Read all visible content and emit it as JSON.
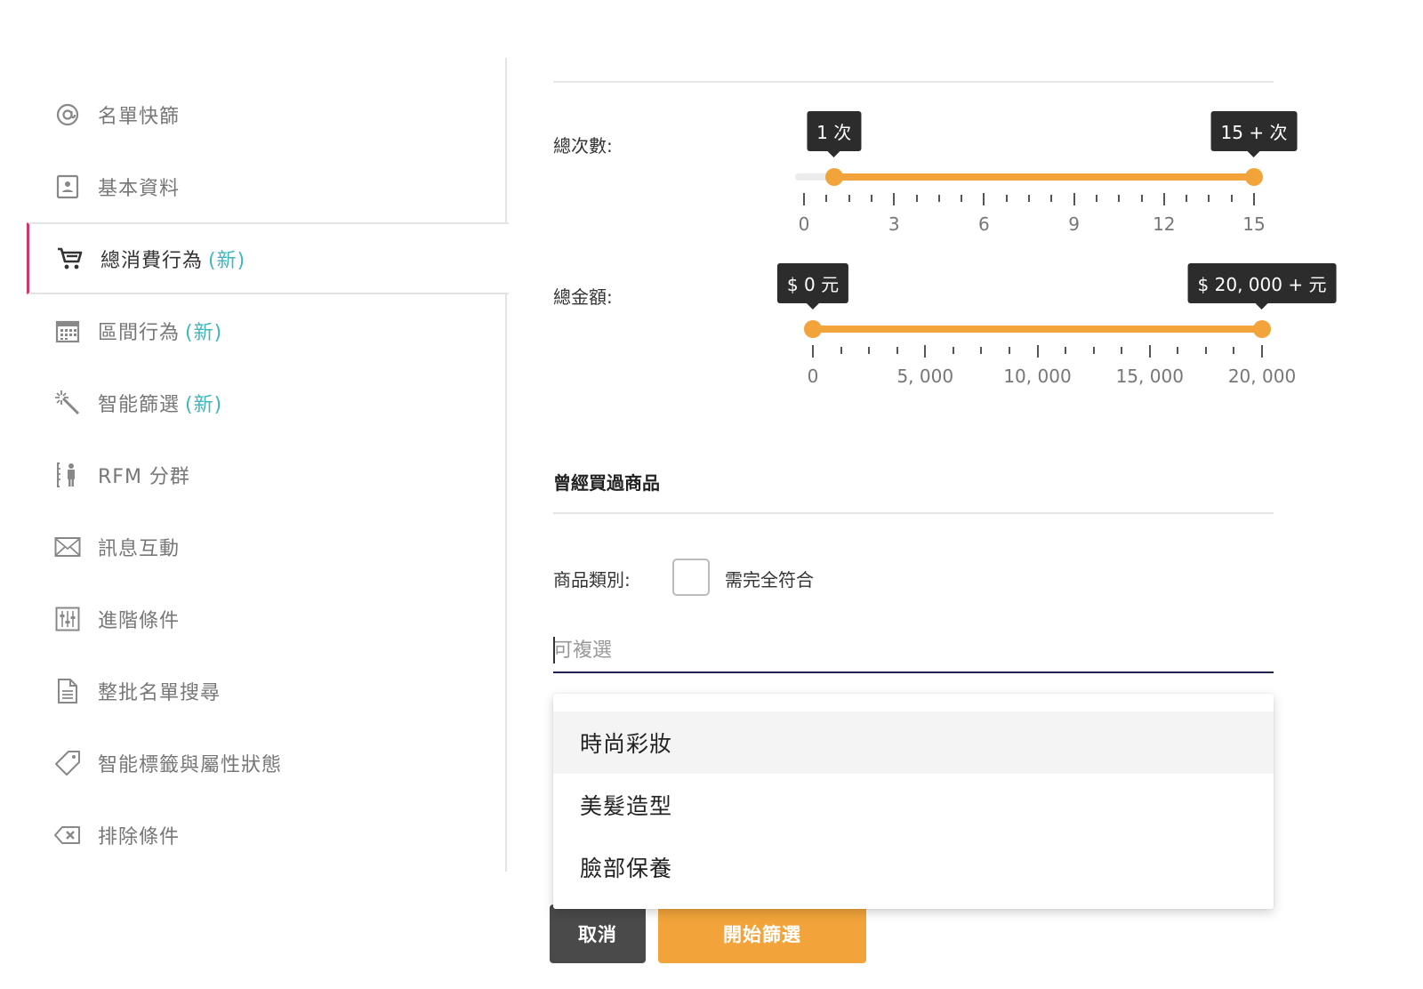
{
  "sidebar": {
    "items": [
      {
        "icon": "at-icon",
        "label": "名單快篩",
        "new": ""
      },
      {
        "icon": "id-card-icon",
        "label": "基本資料",
        "new": ""
      },
      {
        "icon": "cart-icon",
        "label": "總消費行為",
        "new": "(新)"
      },
      {
        "icon": "calendar-icon",
        "label": "區間行為",
        "new": "(新)"
      },
      {
        "icon": "magic-wand-icon",
        "label": "智能篩選",
        "new": "(新)"
      },
      {
        "icon": "rfm-person-icon",
        "label": "RFM 分群",
        "new": ""
      },
      {
        "icon": "envelope-icon",
        "label": "訊息互動",
        "new": ""
      },
      {
        "icon": "sliders-icon",
        "label": "進階條件",
        "new": ""
      },
      {
        "icon": "document-icon",
        "label": "整批名單搜尋",
        "new": ""
      },
      {
        "icon": "tag-icon",
        "label": "智能標籤與屬性狀態",
        "new": ""
      },
      {
        "icon": "backspace-icon",
        "label": "排除條件",
        "new": ""
      }
    ],
    "active_index": 2
  },
  "count_slider": {
    "label": "總次數:",
    "low_tip": "1 次",
    "high_tip": "15 + 次",
    "min": 0,
    "max": 15,
    "low": 1,
    "high": 15,
    "tick_labels": [
      "0",
      "3",
      "6",
      "9",
      "12",
      "15"
    ]
  },
  "amount_slider": {
    "label": "總金額:",
    "low_tip": "$ 0 元",
    "high_tip": "$ 20, 000 + 元",
    "min": 0,
    "max": 20000,
    "low": 0,
    "high": 20000,
    "tick_labels": [
      "0",
      "5, 000",
      "10, 000",
      "15, 000",
      "20, 000"
    ]
  },
  "purchased": {
    "section_title": "曾經買過商品",
    "category_label": "商品類別:",
    "exact_match_label": "需完全符合",
    "exact_match_checked": false,
    "input_placeholder": "可複選",
    "input_value": "",
    "options": [
      "時尚彩妝",
      "美髮造型",
      "臉部保養"
    ],
    "hovered_option": 0
  },
  "actions": {
    "cancel_label": "取消",
    "start_label": "開始篩選"
  },
  "colors": {
    "accent": "#f2a43a",
    "active_marker": "#d8336b",
    "new_badge": "#3fb6bf",
    "input_underline": "#1f2354"
  }
}
